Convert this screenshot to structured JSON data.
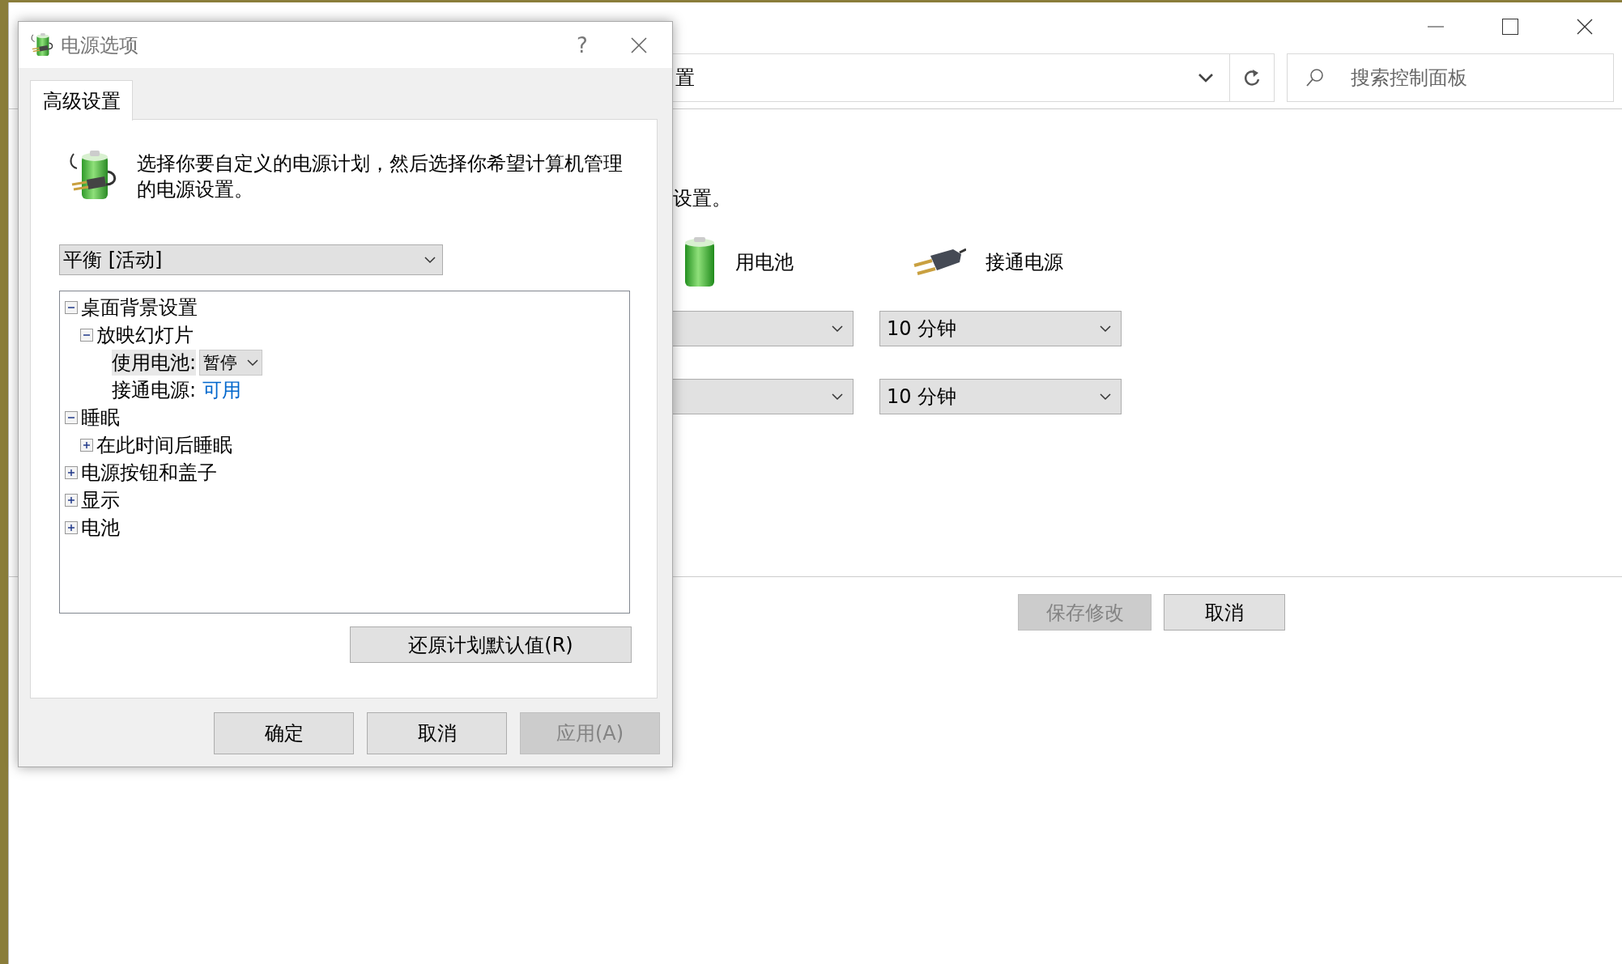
{
  "background_window": {
    "address": {
      "text": "置"
    },
    "search": {
      "placeholder": "搜索控制面板"
    },
    "subtitle": "设置。",
    "columns": [
      {
        "kind": "battery",
        "label": "用电池"
      },
      {
        "kind": "plugged",
        "label": "接通电源"
      }
    ],
    "settings_rows": [
      {
        "plugged_value": "10 分钟"
      },
      {
        "plugged_value": "10 分钟"
      }
    ],
    "buttons": [
      {
        "label": "保存修改",
        "disabled": true
      },
      {
        "label": "取消",
        "disabled": false
      }
    ]
  },
  "dialog": {
    "title": "电源选项",
    "help": "?",
    "tabs": [
      {
        "label": "高级设置",
        "selected": true
      }
    ],
    "description": "选择你要自定义的电源计划，然后选择你希望计算机管理的电源设置。",
    "plan": {
      "value": "平衡 [活动]"
    },
    "tree": [
      {
        "kind": "group",
        "label": "桌面背景设置",
        "expanded": true,
        "selected": false,
        "children": [
          {
            "kind": "group",
            "label": "放映幻灯片",
            "expanded": true,
            "selected": false,
            "children": [
              {
                "kind": "dropdown",
                "label": "使用电池:",
                "value": "暂停",
                "selected": true
              },
              {
                "kind": "link",
                "label": "接通电源:",
                "value": "可用",
                "selected": false
              }
            ]
          }
        ]
      },
      {
        "kind": "group",
        "label": "睡眠",
        "expanded": true,
        "selected": false,
        "children": [
          {
            "kind": "group",
            "label": "在此时间后睡眠",
            "expanded": false,
            "selected": false
          }
        ]
      },
      {
        "kind": "group",
        "label": "电源按钮和盖子",
        "expanded": false,
        "selected": false
      },
      {
        "kind": "group",
        "label": "显示",
        "expanded": false,
        "selected": false
      },
      {
        "kind": "group",
        "label": "电池",
        "expanded": false,
        "selected": false
      }
    ],
    "restore_button": {
      "label": "还原计划默认值(R)"
    },
    "buttons": [
      {
        "label": "确定",
        "disabled": false
      },
      {
        "label": "取消",
        "disabled": false
      },
      {
        "label": "应用(A)",
        "disabled": true
      }
    ]
  }
}
